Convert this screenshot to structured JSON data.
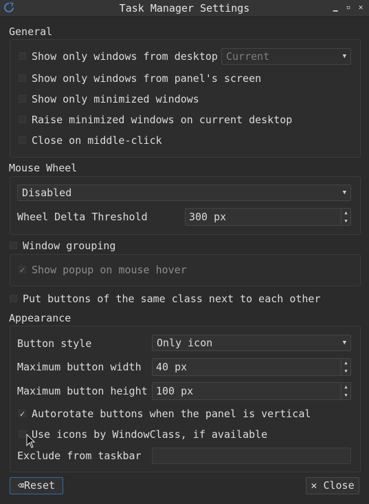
{
  "window": {
    "title": "Task Manager Settings",
    "minimize": "▁",
    "maximize": "▫",
    "close": "✕"
  },
  "general": {
    "label": "General",
    "desktop_filter": {
      "label": "Show only windows from desktop",
      "checked": false,
      "combo_value": "Current"
    },
    "panel_screen": {
      "label": "Show only windows from panel's screen",
      "checked": false
    },
    "minimized_only": {
      "label": "Show only minimized windows",
      "checked": false
    },
    "raise_minimized": {
      "label": "Raise minimized windows on current desktop",
      "checked": false
    },
    "middle_click_close": {
      "label": "Close on middle-click",
      "checked": false
    }
  },
  "mouse_wheel": {
    "label": "Mouse Wheel",
    "mode_value": "Disabled",
    "delta_label": "Wheel Delta Threshold",
    "delta_value": "300 px"
  },
  "grouping": {
    "label": "Window grouping",
    "checked": false,
    "popup_label": "Show popup on mouse hover",
    "popup_checked": true
  },
  "same_class": {
    "label": "Put buttons of the same class next to each other",
    "checked": false
  },
  "appearance": {
    "label": "Appearance",
    "button_style_label": "Button style",
    "button_style_value": "Only icon",
    "max_width_label": "Maximum button width",
    "max_width_value": "40 px",
    "max_height_label": "Maximum button height",
    "max_height_value": "100 px",
    "autorotate": {
      "label": "Autorotate buttons when the panel is vertical",
      "checked": true
    },
    "wmclass_icons": {
      "label": "Use icons by WindowClass, if available",
      "checked": false
    },
    "exclude_label": "Exclude from taskbar",
    "exclude_value": ""
  },
  "buttons": {
    "reset": "Reset",
    "close": "Close"
  },
  "icons": {
    "check": "✓",
    "combo_arrow": "▼",
    "spin_up": "▲",
    "spin_down": "▼",
    "reset_icon": "⌫",
    "close_icon": "✕"
  }
}
